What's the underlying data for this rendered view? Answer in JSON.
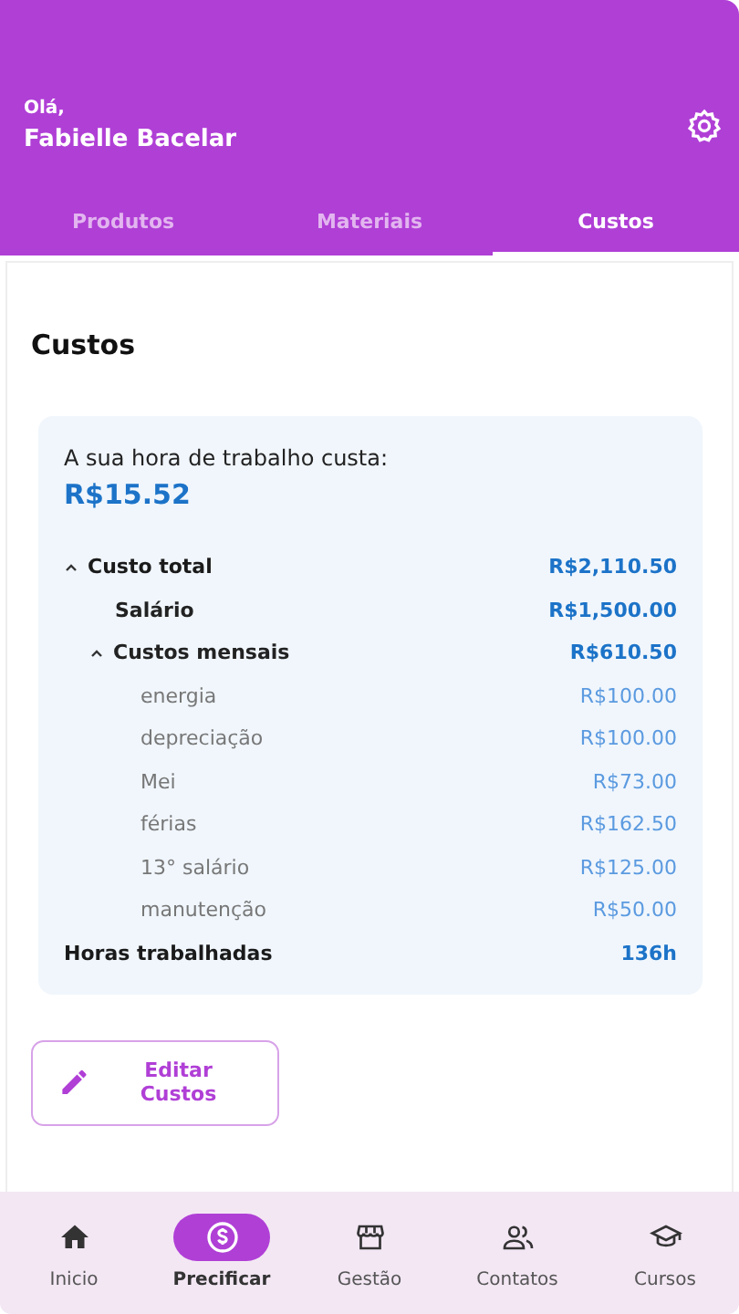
{
  "header": {
    "greeting": "Olá,",
    "name": "Fabielle Bacelar"
  },
  "tabs": [
    {
      "label": "Produtos",
      "selected": false
    },
    {
      "label": "Materiais",
      "selected": false
    },
    {
      "label": "Custos",
      "selected": true
    }
  ],
  "page_title": "Custos",
  "summary": {
    "label": "A sua hora de trabalho custa:",
    "value": "R$15.52"
  },
  "costs": [
    {
      "label": "Custo total",
      "value": "R$2,110.50",
      "expanded": true,
      "children": [
        {
          "label": "Salário",
          "value": "R$1,500.00"
        },
        {
          "label": "Custos mensais",
          "value": "R$610.50",
          "expanded": true,
          "children": [
            {
              "label": "energia",
              "value": "R$100.00"
            },
            {
              "label": "depreciação",
              "value": "R$100.00"
            },
            {
              "label": "Mei",
              "value": "R$73.00"
            },
            {
              "label": "férias",
              "value": "R$162.50"
            },
            {
              "label": "13° salário",
              "value": "R$125.00"
            },
            {
              "label": "manutenção",
              "value": "R$50.00"
            }
          ]
        }
      ]
    },
    {
      "label": "Horas trabalhadas",
      "value": "136h"
    }
  ],
  "edit_button": "Editar Custos",
  "nav": [
    {
      "label": "Inicio",
      "selected": false
    },
    {
      "label": "Precificar",
      "selected": true
    },
    {
      "label": "Gestão",
      "selected": false
    },
    {
      "label": "Contatos",
      "selected": false
    },
    {
      "label": "Cursos",
      "selected": false
    }
  ]
}
